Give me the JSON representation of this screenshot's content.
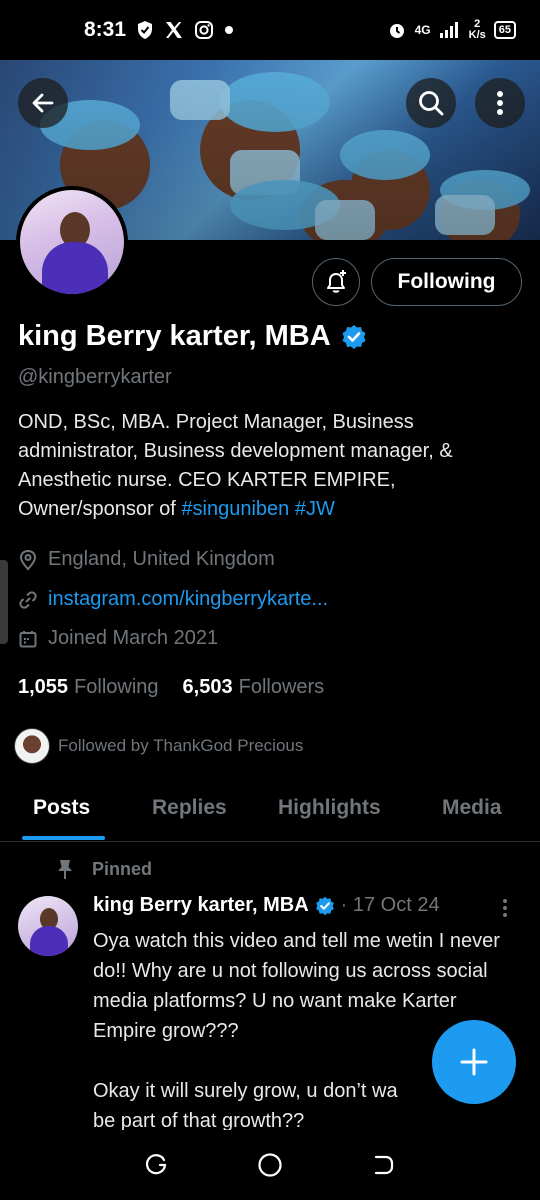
{
  "status_bar": {
    "time": "8:31",
    "network": "4G",
    "speed_value": "2",
    "speed_unit": "K/s",
    "battery": "65",
    "icons": [
      "shield-icon",
      "x-logo-icon",
      "instagram-icon",
      "dot-icon",
      "alarm-icon",
      "signal-icon",
      "signal-icon"
    ]
  },
  "header": {
    "back_icon": "arrow-left-icon",
    "search_icon": "search-icon",
    "more_icon": "more-vertical-icon"
  },
  "profile": {
    "name": "king Berry karter, MBA",
    "verified": true,
    "handle": "@kingberrykarter",
    "bio_text": "OND, BSc, MBA. Project Manager, Business administrator, Business development manager, & Anesthetic nurse. CEO KARTER EMPIRE, Owner/sponsor of ",
    "bio_tags": [
      "#singuniben",
      "#JW"
    ],
    "location": "England, United Kingdom",
    "website": "instagram.com/kingberrykarte...",
    "joined": "Joined March 2021",
    "following_count": "1,055",
    "following_label": "Following",
    "followers_count": "6,503",
    "followers_label": "Followers",
    "followed_by": "Followed by ThankGod Precious"
  },
  "actions": {
    "notify_icon": "bell-plus-icon",
    "following_button": "Following"
  },
  "tabs": [
    {
      "label": "Posts",
      "active": true
    },
    {
      "label": "Replies",
      "active": false
    },
    {
      "label": "Highlights",
      "active": false
    },
    {
      "label": "Media",
      "active": false
    }
  ],
  "pinned_post": {
    "pinned_label": "Pinned",
    "author": "king Berry karter, MBA",
    "date": "· 17 Oct 24",
    "text": "Oya watch this video and tell me wetin I never do!! Why are u not following us across social media platforms? U no want make Karter Empire grow???\n\nOkay it will surely grow, u don’t wa\nbe part of that growth??"
  },
  "colors": {
    "accent": "#1d9bf0",
    "background": "#000000",
    "muted_text": "#71767b",
    "primary_text": "#e7e9ea"
  },
  "fab_icon": "plus-icon",
  "navbar_icons": [
    "recent-apps-icon",
    "home-circle-icon",
    "back-nav-icon"
  ]
}
